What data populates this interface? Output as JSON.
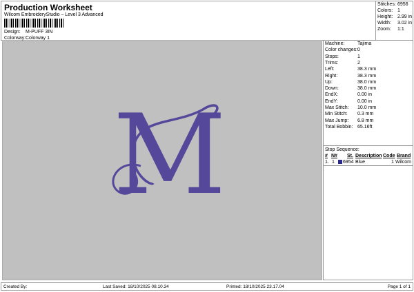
{
  "header": {
    "title": "Production Worksheet",
    "subtitle": "Wilcom EmbroideryStudio – Level 3 Advanced",
    "design_label": "Design:",
    "design": "M-PUFF 3IN",
    "colorway_label": "Colorway:",
    "colorway": "Colorway 1"
  },
  "stats": [
    {
      "k": "Stitches:",
      "v": "6956"
    },
    {
      "k": "Colors:",
      "v": "1"
    },
    {
      "k": "Height:",
      "v": "2.99 in"
    },
    {
      "k": "Width:",
      "v": "3.02 in"
    },
    {
      "k": "Zoom:",
      "v": "1:1"
    }
  ],
  "details": [
    {
      "k": "Machine:",
      "v": "Tajima"
    },
    {
      "k": "Color changes:",
      "v": "0"
    },
    {
      "k": "Stops:",
      "v": "1"
    },
    {
      "k": "Trims:",
      "v": "2"
    },
    {
      "k": "Left:",
      "v": "38.3 mm"
    },
    {
      "k": "Right:",
      "v": "38.3 mm"
    },
    {
      "k": "Up:",
      "v": "38.0 mm"
    },
    {
      "k": "Down:",
      "v": "38.0 mm"
    },
    {
      "k": "EndX:",
      "v": "0.00 in"
    },
    {
      "k": "EndY:",
      "v": "0.00 in"
    },
    {
      "k": "Max Stitch:",
      "v": "10.0 mm"
    },
    {
      "k": "Min Stitch:",
      "v": "0.3 mm"
    },
    {
      "k": "Max Jump:",
      "v": "6.8 mm"
    },
    {
      "k": "Total Bobbin:",
      "v": "65.16ft"
    }
  ],
  "stop_sequence": {
    "title": "Stop Sequence:",
    "columns": [
      "#",
      "N#",
      "St.",
      "Description",
      "Code",
      "Brand"
    ],
    "rows": [
      {
        "num": "1.",
        "n": "1",
        "color": "#2b2a8a",
        "st": "6954",
        "desc": "Blue",
        "code": "1",
        "brand": "Wilcom"
      }
    ]
  },
  "design_color": "#55479a",
  "footer": {
    "created": "Created By:",
    "saved": "Last Saved: 18/10/2025 08.10.34",
    "printed": "Printed: 18/10/2025 23.17.04",
    "page": "Page 1 of 1"
  }
}
